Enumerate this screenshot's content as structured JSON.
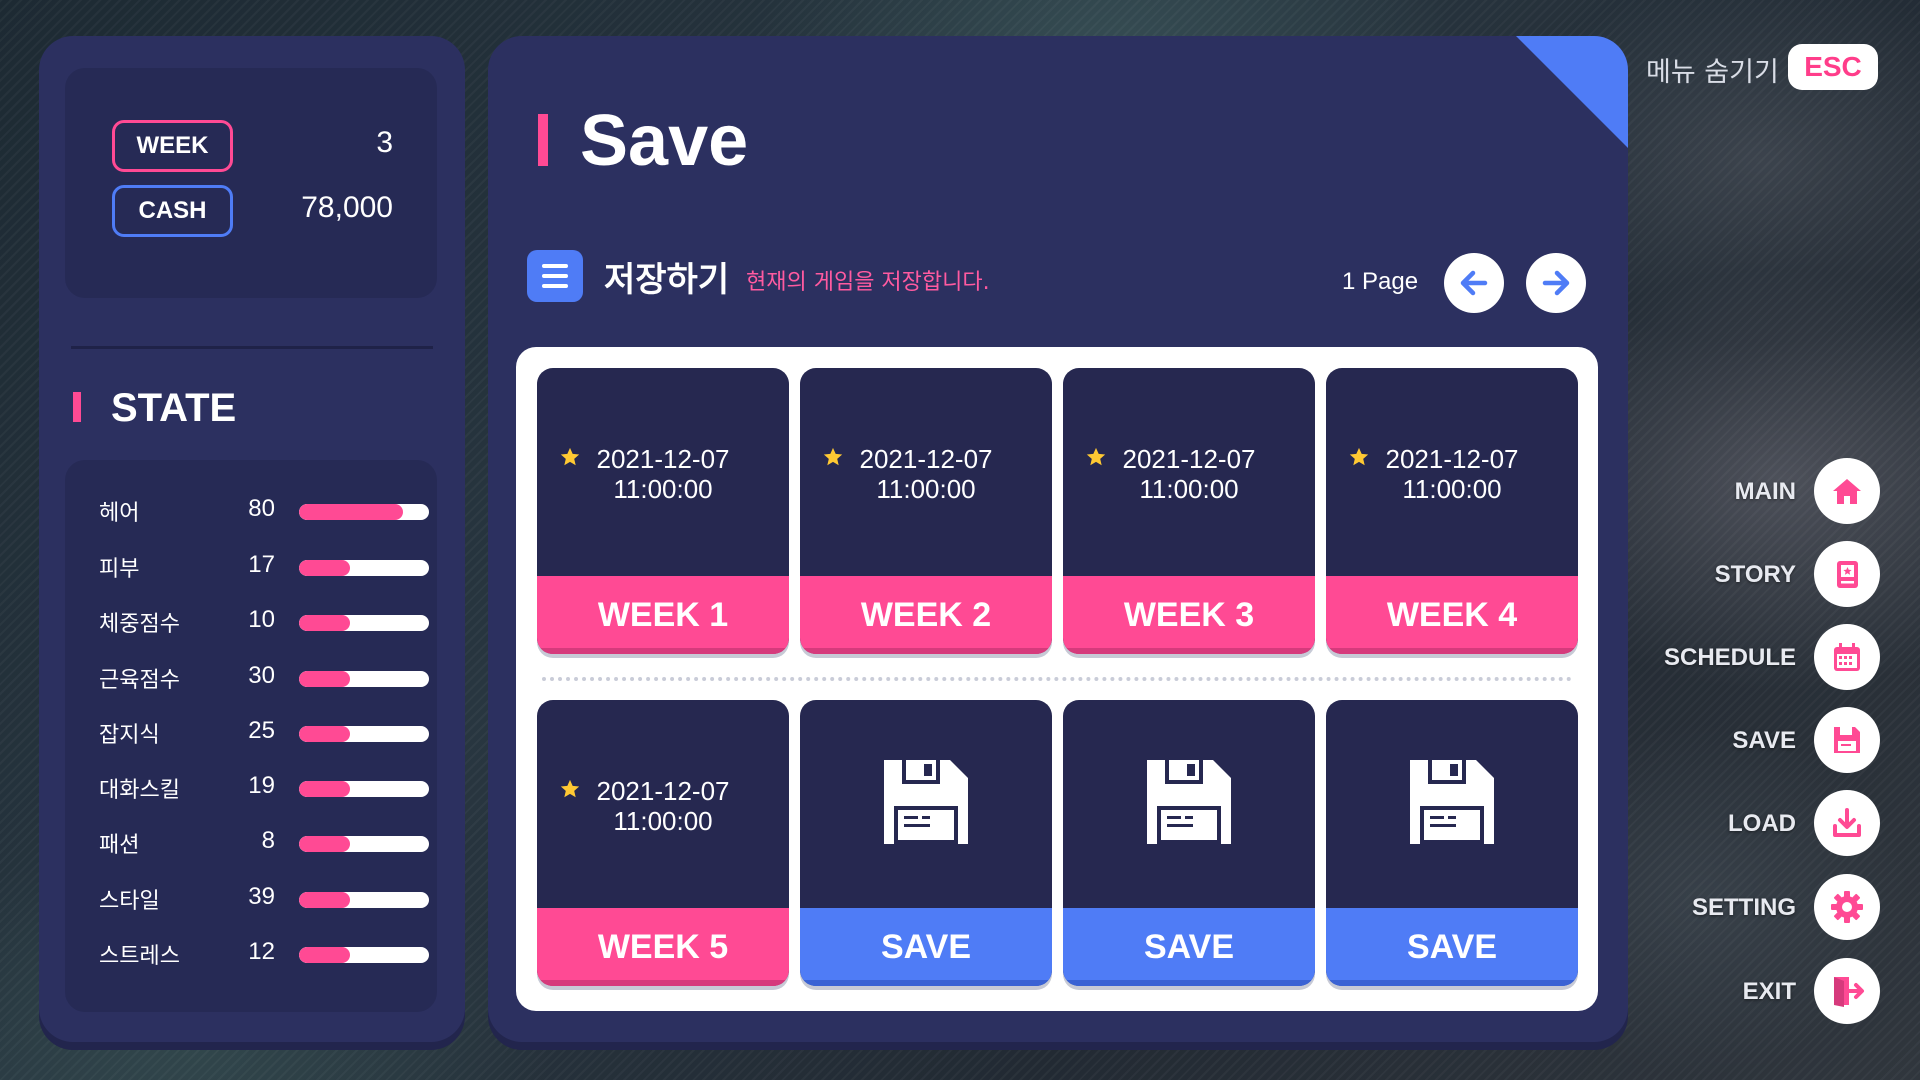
{
  "player": {
    "week_label": "WEEK",
    "week_value": "3",
    "cash_label": "CASH",
    "cash_value": "78,000"
  },
  "state": {
    "title": "STATE",
    "items": [
      {
        "label": "헤어",
        "value": "80",
        "fraction": 0.8
      },
      {
        "label": "피부",
        "value": "17",
        "fraction": 0.39
      },
      {
        "label": "체중점수",
        "value": "10",
        "fraction": 0.39
      },
      {
        "label": "근육점수",
        "value": "30",
        "fraction": 0.39
      },
      {
        "label": "잡지식",
        "value": "25",
        "fraction": 0.39
      },
      {
        "label": "대화스킬",
        "value": "19",
        "fraction": 0.39
      },
      {
        "label": "패션",
        "value": "8",
        "fraction": 0.39
      },
      {
        "label": "스타일",
        "value": "39",
        "fraction": 0.39
      },
      {
        "label": "스트레스",
        "value": "12",
        "fraction": 0.39
      }
    ]
  },
  "main": {
    "title": "Save",
    "section_title": "저장하기",
    "section_desc": "현재의 게임을 저장합니다.",
    "page_label": "1 Page",
    "slots": [
      {
        "date": "2021-12-07",
        "time": "11:00:00",
        "label": "WEEK 1",
        "filled": true
      },
      {
        "date": "2021-12-07",
        "time": "11:00:00",
        "label": "WEEK 2",
        "filled": true
      },
      {
        "date": "2021-12-07",
        "time": "11:00:00",
        "label": "WEEK 3",
        "filled": true
      },
      {
        "date": "2021-12-07",
        "time": "11:00:00",
        "label": "WEEK 4",
        "filled": true
      },
      {
        "date": "2021-12-07",
        "time": "11:00:00",
        "label": "WEEK 5",
        "filled": true
      },
      {
        "date": "",
        "time": "",
        "label": "SAVE",
        "filled": false
      },
      {
        "date": "",
        "time": "",
        "label": "SAVE",
        "filled": false
      },
      {
        "date": "",
        "time": "",
        "label": "SAVE",
        "filled": false
      }
    ]
  },
  "menu": {
    "hide_label": "메뉴 숨기기",
    "esc_label": "ESC",
    "items": [
      {
        "label": "MAIN",
        "icon": "home-icon"
      },
      {
        "label": "STORY",
        "icon": "book-icon"
      },
      {
        "label": "SCHEDULE",
        "icon": "calendar-icon"
      },
      {
        "label": "SAVE",
        "icon": "floppy-disk-icon"
      },
      {
        "label": "LOAD",
        "icon": "download-icon"
      },
      {
        "label": "SETTING",
        "icon": "gear-icon"
      },
      {
        "label": "EXIT",
        "icon": "exit-door-icon"
      }
    ]
  },
  "colors": {
    "accent_pink": "#ff4a94",
    "accent_blue": "#4f7cf6",
    "panel": "#2c3060",
    "panel_inner": "#262a55"
  }
}
